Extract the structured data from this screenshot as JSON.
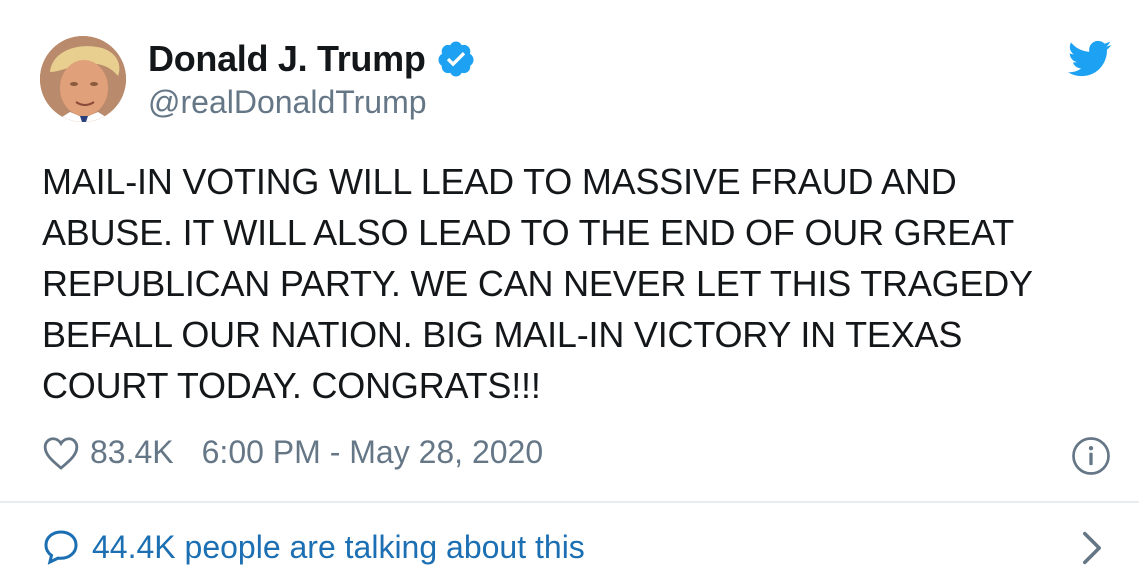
{
  "author": {
    "display_name": "Donald J. Trump",
    "handle": "@realDonaldTrump",
    "verified": true
  },
  "tweet": {
    "text": "MAIL-IN VOTING WILL LEAD TO MASSIVE FRAUD AND\nABUSE. IT WILL ALSO LEAD TO THE END OF OUR GREAT\nREPUBLICAN PARTY. WE CAN NEVER LET THIS TRAGEDY\nBEFALL OUR NATION. BIG MAIL-IN VICTORY IN TEXAS\nCOURT TODAY. CONGRATS!!!",
    "like_count": "83.4K",
    "timestamp": "6:00 PM - May 28, 2020"
  },
  "footer": {
    "talking_label": "44.4K people are talking about this"
  },
  "icons": {
    "bird": "twitter-bird-icon",
    "verified": "verified-badge-icon",
    "like": "heart-icon",
    "info": "info-icon",
    "reply": "speech-bubble-icon",
    "chevron": "chevron-right-icon"
  },
  "colors": {
    "brand": "#1da1f2",
    "secondary_text": "#657786",
    "link": "#1b6fb2",
    "divider": "#e6ecf0"
  }
}
